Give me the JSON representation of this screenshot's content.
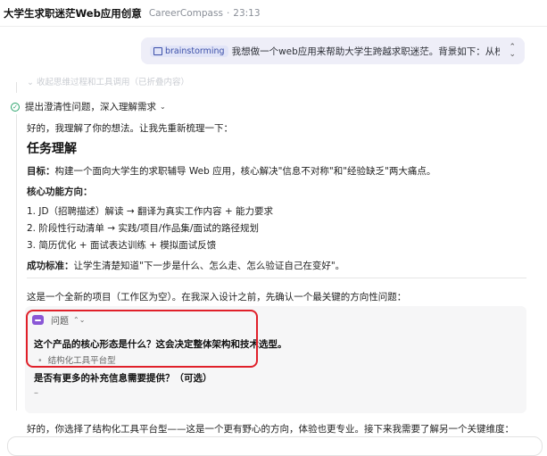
{
  "header": {
    "title": "大学生求职迷茫Web应用创意",
    "project": "CareerCompass",
    "time": "23:13"
  },
  "user_message": {
    "tag": "brainstorming",
    "text": "我想做一个web应用来帮助大学生跨越求职迷茫。背景如下：从校园走向职场，"
  },
  "faded_step": "⌄  收起思维过程和工具调用（已折叠内容）",
  "step": {
    "label": "提出澄清性问题，深入理解需求"
  },
  "assistant": {
    "intro": "好的，我理解了你的想法。让我先重新梳理一下：",
    "heading": "任务理解",
    "goal_label": "目标：",
    "goal_text": "构建一个面向大学生的求职辅导 Web 应用，核心解决\"信息不对称\"和\"经验缺乏\"两大痛点。",
    "core_title": "核心功能方向：",
    "items": [
      "1. JD（招聘描述）解读 → 翻译为真实工作内容 + 能力要求",
      "2. 阶段性行动清单 → 实践/项目/作品集/面试的路径规划",
      "3. 简历优化 + 面试表达训练 + 模拟面试反馈"
    ],
    "criteria_label": "成功标准：",
    "criteria_text": "让学生清楚知道\"下一步是什么、怎么走、怎么验证自己在变好\"。",
    "project_note": "这是一个全新的项目（工作区为空）。在我深入设计之前，先确认一个最关键的方向性问题：",
    "bottom_text": "好的，你选择了结构化工具平台型——这是一个更有野心的方向，体验也更专业。接下来我需要了解另一个关键维度："
  },
  "question_card": {
    "label": "问题",
    "q1": "这个产品的核心形态是什么？这会决定整体架构和技术选型。",
    "q1_answer": "结构化工具平台型",
    "q2": "是否有更多的补充信息需要提供？（可选）",
    "q2_answer": "–"
  },
  "colors": {
    "accent_purple": "#8a57d6",
    "highlight_red": "#e0202a",
    "check_green": "#2aa36b",
    "bubble_bg": "#eeeef8"
  }
}
